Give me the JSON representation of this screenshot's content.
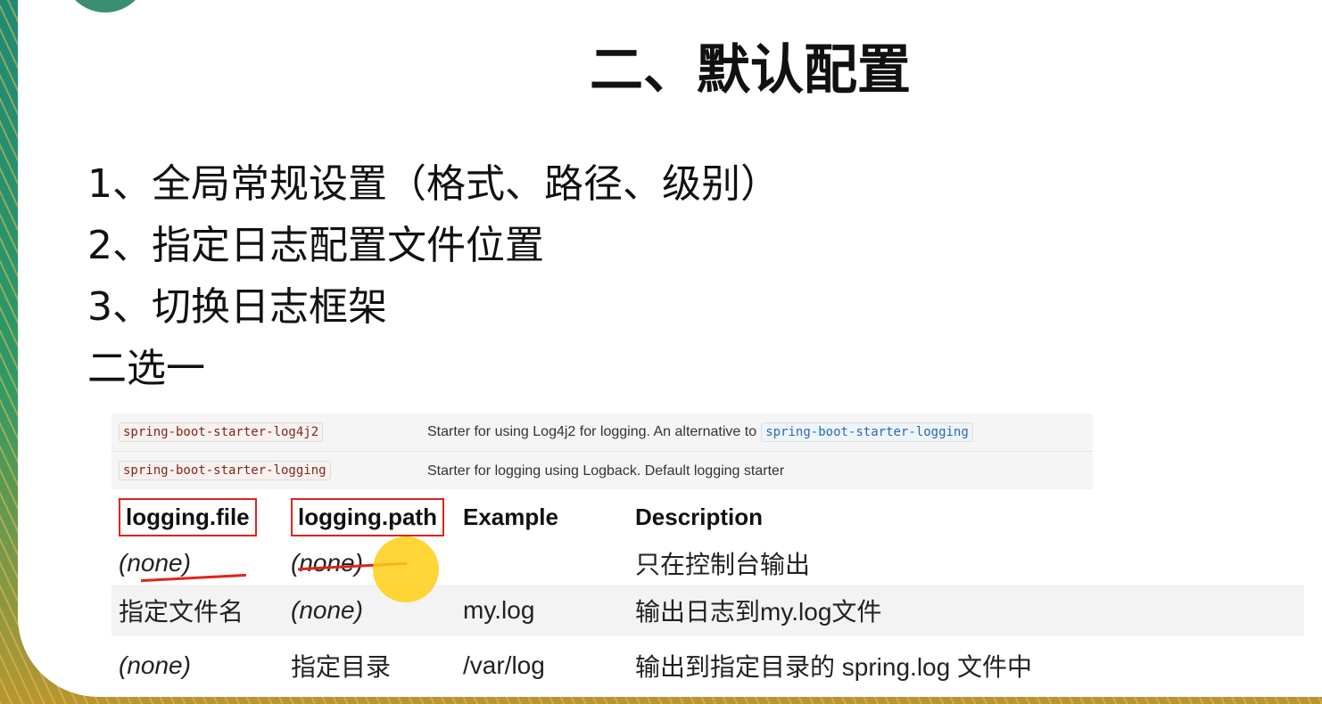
{
  "slide": {
    "title": "二、默认配置",
    "points": [
      "1、全局常规设置（格式、路径、级别）",
      "2、指定日志配置文件位置",
      "3、切换日志框架",
      "二选一"
    ]
  },
  "starters": [
    {
      "name": "spring-boot-starter-log4j2",
      "description": "Starter for using Log4j2 for logging. An alternative to",
      "link": "spring-boot-starter-logging"
    },
    {
      "name": "spring-boot-starter-logging",
      "description": "Starter for logging using Logback. Default logging starter",
      "link": ""
    }
  ],
  "properties": {
    "headers": [
      "logging.file",
      "logging.path",
      "Example",
      "Description"
    ],
    "rows": [
      [
        "(none)",
        "(none)",
        "",
        "只在控制台输出"
      ],
      [
        "指定文件名",
        "(none)",
        "my.log",
        "输出日志到my.log文件"
      ],
      [
        "(none)",
        "指定目录",
        "/var/log",
        "输出到指定目录的 spring.log 文件中"
      ]
    ]
  },
  "colors": {
    "annotation_red": "#e0241b",
    "pointer_yellow": "#ffce14",
    "frame_teal": "#1f8a73"
  }
}
